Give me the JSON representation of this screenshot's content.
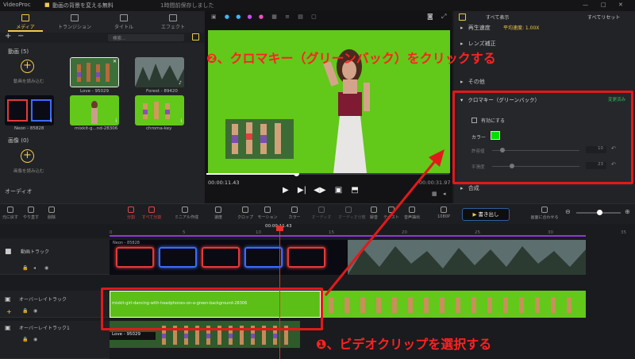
{
  "app": {
    "name": "VideoProc",
    "document_title": "動画の背景を変える無料",
    "autosave": "1時間前保存しました"
  },
  "left_tabs": [
    "メディア",
    "トランジション",
    "タイトル",
    "エフェクト"
  ],
  "media": {
    "search_placeholder": "検索...",
    "video_section": "動画 (5)",
    "import_video": "動画を読み込む",
    "clips": [
      "Love - 95029",
      "Forest - 89420",
      "Neon - 85828",
      "mixkit-g...nd-28306",
      "chroma-key"
    ],
    "image_section": "画像 (0)",
    "import_image": "画像を読み込む",
    "audio_section": "オーディオ"
  },
  "preview": {
    "time_current": "00:00:11.43",
    "time_total": "00:00:31.97"
  },
  "inspector": {
    "tab_label": "すべて表示",
    "reset_all": "すべてリセット",
    "speed_label": "再生速度",
    "speed_value": "平均速度: 1.00X",
    "lens_label": "レンズ補正",
    "other_label": "その他",
    "chroma_title": "クロマキー（グリーンバック）",
    "chroma_status": "変更済み",
    "enable_label": "有効にする",
    "color_label": "カラー",
    "color_value": "#00e000",
    "similarity_label": "許容値",
    "similarity_value": "10",
    "smooth_label": "平滑度",
    "smooth_value": "23",
    "composite_label": "合成"
  },
  "toolbar": {
    "tools": [
      "元に戻す",
      "やり直す",
      "削除",
      "分割",
      "すべて分割",
      "ミニアル作成",
      "速度",
      "クロップ",
      "モーション",
      "カラー",
      "オーディオ",
      "オーディオ分離",
      "録音",
      "テキスト",
      "音声抽出",
      "1080P"
    ],
    "export_label": "書き出し",
    "fit_label": "画面に合わせる"
  },
  "timeline": {
    "playhead_time": "00:00:11.43",
    "ruler": [
      "0",
      "5",
      "10",
      "15",
      "20",
      "25",
      "30",
      "35"
    ],
    "video_track": "動画トラック",
    "overlay_track": "オーバーレイトラック",
    "overlay_track_1": "オーバーレイトラック1",
    "neon_clip": "Neon - 85828",
    "green_clip": "mixkit-girl-dancing-with-headphones-on-a-green-background-28306",
    "love_clip": "Love - 95029"
  },
  "annotations": {
    "step1": "❶、ビデオクリップを選択する",
    "step2": "❷、クロマキー（グリーンバック）をクリックする"
  },
  "colors": {
    "accent": "#f2c94c",
    "annotation_red": "#e01a1a",
    "green_screen": "#62c81a",
    "playhead": "#e0352b"
  }
}
